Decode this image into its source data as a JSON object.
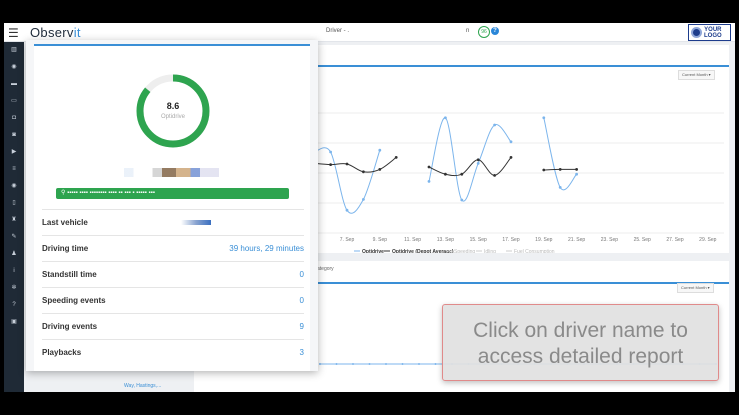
{
  "header": {
    "brand_a": "Observ",
    "brand_b": "it",
    "driver_title": "Driver - .",
    "partial": "n",
    "badge": "96",
    "help": "?",
    "logo_line1": "YOUR",
    "logo_line2": "LOGO"
  },
  "sidebar": {
    "icons": [
      "chart-icon",
      "dashboard-icon",
      "car-icon",
      "truck-icon",
      "vehicle-icon",
      "vehicle-alt-icon",
      "play-icon",
      "filter-icon",
      "eye-icon",
      "mobile-icon",
      "trophy-icon",
      "wrench-icon",
      "user-icon",
      "info-icon",
      "gear-icon",
      "help-icon",
      "export-icon"
    ]
  },
  "driver_card": {
    "score": "8.6",
    "score_label": "Optidrive",
    "score_fraction": 0.86,
    "address": "▪▪▪▪▪ ▪▪▪▪ ▪▪▪▪▪▪▪▪ ▪▪▪▪ ▪▪ ▪▪▪ ▪ ▪▪▪▪▪ ▪▪▪",
    "rows": [
      {
        "label": "Last vehicle",
        "value": ""
      },
      {
        "label": "Driving time",
        "value": "39 hours, 29 minutes"
      },
      {
        "label": "Standstill time",
        "value": "0"
      },
      {
        "label": "Speeding events",
        "value": "0"
      },
      {
        "label": "Driving events",
        "value": "9"
      },
      {
        "label": "Playbacks",
        "value": "3"
      }
    ]
  },
  "panel1": {
    "range_button": "Current Month ▾"
  },
  "panel2": {
    "title_partial": "ategory",
    "range_button": "Current Month ▾"
  },
  "below_card_text": "Way, Hastings,...",
  "tooltip": {
    "line1": "Click on driver name to",
    "line2": "access detailed report"
  },
  "colors": {
    "accent": "#3a8fd6",
    "green": "#2ea44f",
    "sidebar": "#1f2a36"
  },
  "chart_data": {
    "type": "line",
    "xlabel": "",
    "ylabel": "",
    "ylim": [
      0,
      10
    ],
    "grid": true,
    "x_ticks": [
      "7. Sep",
      "9. Sep",
      "11. Sep",
      "13. Sep",
      "15. Sep",
      "17. Sep",
      "19. Sep",
      "21. Sep",
      "23. Sep",
      "25. Sep",
      "27. Sep",
      "29. Sep"
    ],
    "x_tick_days": [
      7,
      9,
      11,
      13,
      15,
      17,
      19,
      21,
      23,
      25,
      27,
      29
    ],
    "legend": [
      "Optidrive",
      "Optidrive (Depot Average)",
      "Speeding",
      "Idling",
      "Fuel Consumption"
    ],
    "legend_placement": "bottom",
    "series": [
      {
        "name": "Optidrive",
        "color": "#7cb5ec",
        "segments": [
          [
            [
              5,
              6.75
            ],
            [
              6,
              6.75
            ],
            [
              7,
              1.9
            ],
            [
              8,
              2.8
            ],
            [
              9,
              6.9
            ]
          ],
          [
            [
              12,
              4.3
            ],
            [
              13,
              9.6
            ],
            [
              14,
              2.75
            ],
            [
              15,
              5.8
            ],
            [
              16,
              9.0
            ],
            [
              17,
              7.6
            ]
          ],
          [
            [
              19,
              9.6
            ],
            [
              20,
              3.8
            ],
            [
              21,
              4.9
            ]
          ]
        ]
      },
      {
        "name": "Optidrive (Depot Average)",
        "color": "#333333",
        "segments": [
          [
            [
              5,
              5.8
            ],
            [
              6,
              5.7
            ],
            [
              7,
              5.75
            ],
            [
              8,
              5.1
            ],
            [
              9,
              5.3
            ],
            [
              10,
              6.3
            ]
          ],
          [
            [
              12,
              5.5
            ],
            [
              13,
              4.9
            ],
            [
              14,
              4.9
            ],
            [
              15,
              6.1
            ],
            [
              16,
              4.8
            ],
            [
              17,
              6.3
            ]
          ],
          [
            [
              19,
              5.25
            ],
            [
              20,
              5.3
            ],
            [
              21,
              5.3
            ]
          ]
        ]
      }
    ]
  }
}
